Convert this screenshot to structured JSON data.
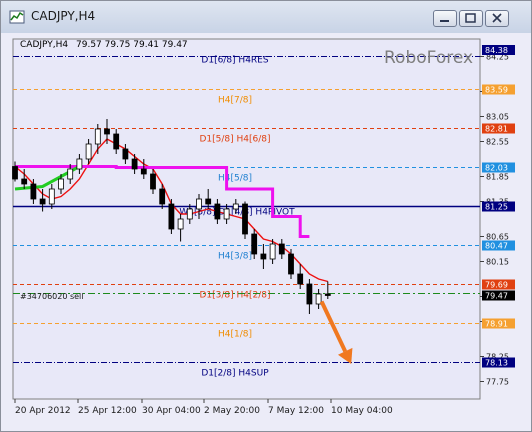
{
  "window": {
    "title": "CADJPY,H4",
    "buttons": [
      "minimize",
      "maximize",
      "close"
    ]
  },
  "chart_header": {
    "symbol": "CADJPY,H4",
    "ohlc": "79.57 79.75 79.41 79.47",
    "watermark": "RoboForex",
    "order_label": "#34706020 sell"
  },
  "colors": {
    "background": "#e8e8f8",
    "candles": "#000000",
    "red_line": "#ee1111",
    "magenta_line": "#ee11ee",
    "green_line": "#22cc22",
    "navy_line": "#000080",
    "arrow": "#f07820"
  },
  "chart_data": {
    "type": "candlestick",
    "symbol": "CADJPY",
    "timeframe": "H4",
    "ylim": [
      77.4,
      84.6
    ],
    "y_ticks": [
      "84.25",
      "83.55",
      "83.05",
      "82.55",
      "81.85",
      "81.35",
      "80.65",
      "80.15",
      "79.45",
      "78.95",
      "78.25",
      "77.75"
    ],
    "x_ticks": [
      "20 Apr 2012",
      "25 Apr 12:00",
      "30 Apr 04:00",
      "2 May 20:00",
      "7 May 12:00",
      "10 May 04:00"
    ],
    "last_price": 79.47,
    "levels": [
      {
        "label": "D1[6/8] H4RES",
        "price": 84.25,
        "color": "#000080",
        "style": "dashdot",
        "price_label": "84.38",
        "label_color": "#000080"
      },
      {
        "label": "H4[7/8]",
        "price": 83.59,
        "color": "#f5a030",
        "style": "dash",
        "price_label": "83.59",
        "label_color": "#f08c00"
      },
      {
        "label": "D1[5/8] H4[6/8]",
        "price": 82.81,
        "color": "#e04010",
        "style": "dash",
        "price_label": "82.81",
        "label_color": "#e04010"
      },
      {
        "label": "H4[5/8]",
        "price": 82.03,
        "color": "#2090e0",
        "style": "dash",
        "price_label": "82.03",
        "label_color": "#2080d0"
      },
      {
        "label": "W1[5/8] D1[4/8] H4PIVOT",
        "price": 81.25,
        "color": "#000080",
        "style": "solid",
        "price_label": "81.25",
        "label_color": "#000080"
      },
      {
        "label": "H4[3/8]",
        "price": 80.47,
        "color": "#2090e0",
        "style": "dash",
        "price_label": "80.47",
        "label_color": "#2080d0"
      },
      {
        "label": "D1[3/8] H4[2/8]",
        "price": 79.69,
        "color": "#e04010",
        "style": "dash",
        "price_label": "79.69",
        "label_color": "#e04010"
      },
      {
        "label": "H4[1/8]",
        "price": 78.91,
        "color": "#f5a030",
        "style": "dash",
        "price_label": "78.91",
        "label_color": "#f08c00"
      },
      {
        "label": "D1[2/8] H4SUP",
        "price": 78.13,
        "color": "#000080",
        "style": "dashdot",
        "price_label": "78.13",
        "label_color": "#000080"
      }
    ],
    "order_line_price": 79.51,
    "candles": [
      [
        82.05,
        82.15,
        81.75,
        81.8
      ],
      [
        81.8,
        82.0,
        81.6,
        81.7
      ],
      [
        81.7,
        81.8,
        81.3,
        81.4
      ],
      [
        81.4,
        81.6,
        81.15,
        81.3
      ],
      [
        81.3,
        81.7,
        81.2,
        81.6
      ],
      [
        81.6,
        81.9,
        81.5,
        81.8
      ],
      [
        81.8,
        82.1,
        81.7,
        82.0
      ],
      [
        82.0,
        82.3,
        81.9,
        82.2
      ],
      [
        82.2,
        82.6,
        82.1,
        82.5
      ],
      [
        82.5,
        82.9,
        82.3,
        82.8
      ],
      [
        82.8,
        83.0,
        82.5,
        82.7
      ],
      [
        82.7,
        82.8,
        82.3,
        82.4
      ],
      [
        82.4,
        82.5,
        82.1,
        82.2
      ],
      [
        82.2,
        82.3,
        81.9,
        82.0
      ],
      [
        82.0,
        82.2,
        81.8,
        81.9
      ],
      [
        81.9,
        82.0,
        81.5,
        81.6
      ],
      [
        81.6,
        81.7,
        81.2,
        81.3
      ],
      [
        81.3,
        81.4,
        80.7,
        80.8
      ],
      [
        80.8,
        81.1,
        80.55,
        81.0
      ],
      [
        81.0,
        81.3,
        80.9,
        81.2
      ],
      [
        81.2,
        81.5,
        81.0,
        81.4
      ],
      [
        81.4,
        81.6,
        81.2,
        81.3
      ],
      [
        81.3,
        81.4,
        80.9,
        81.0
      ],
      [
        81.0,
        81.3,
        80.9,
        81.2
      ],
      [
        81.2,
        81.4,
        81.1,
        81.3
      ],
      [
        81.3,
        81.35,
        80.6,
        80.7
      ],
      [
        80.7,
        80.8,
        80.2,
        80.3
      ],
      [
        80.3,
        80.5,
        80.0,
        80.2
      ],
      [
        80.2,
        80.6,
        80.1,
        80.5
      ],
      [
        80.5,
        80.6,
        80.2,
        80.3
      ],
      [
        80.3,
        80.4,
        79.8,
        79.9
      ],
      [
        79.9,
        80.1,
        79.6,
        79.7
      ],
      [
        79.7,
        79.8,
        79.1,
        79.3
      ],
      [
        79.3,
        79.6,
        79.2,
        79.5
      ],
      [
        79.5,
        79.75,
        79.4,
        79.47
      ]
    ],
    "red_line": [
      82.05,
      81.9,
      81.7,
      81.5,
      81.4,
      81.45,
      81.6,
      81.8,
      82.1,
      82.4,
      82.6,
      82.5,
      82.4,
      82.25,
      82.1,
      82.0,
      81.7,
      81.3,
      81.1,
      81.1,
      81.15,
      81.2,
      81.15,
      81.1,
      81.05,
      81.0,
      80.8,
      80.6,
      80.55,
      80.45,
      80.3,
      80.1,
      79.9,
      79.8,
      79.75
    ],
    "magenta_line": [
      [
        0,
        82.05
      ],
      [
        11,
        82.05
      ],
      [
        11,
        82.03
      ],
      [
        23,
        82.03
      ],
      [
        23,
        81.6
      ],
      [
        28,
        81.6
      ],
      [
        28,
        81.05
      ],
      [
        31,
        81.05
      ],
      [
        31,
        80.65
      ],
      [
        32,
        80.65
      ]
    ],
    "green_line": [
      [
        0,
        81.6
      ],
      [
        3,
        81.65
      ],
      [
        5,
        81.85
      ],
      [
        7,
        82.05
      ]
    ],
    "forecast_arrow": {
      "from": [
        33,
        79.35
      ],
      "to": [
        36,
        78.1
      ]
    }
  }
}
